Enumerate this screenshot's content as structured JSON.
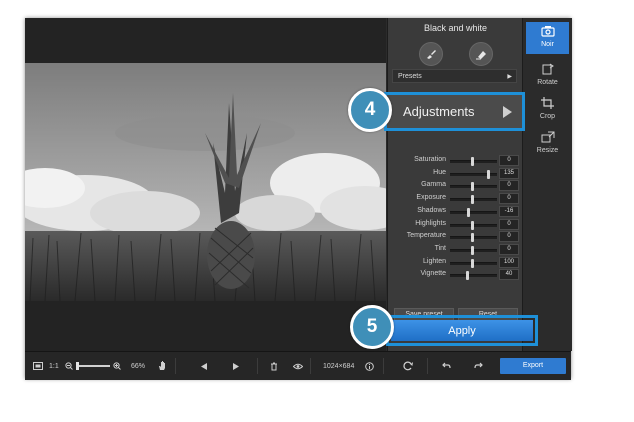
{
  "panel": {
    "title": "Black and white",
    "presets_label": "Presets",
    "adjustments_label": "Adjustments",
    "sliders": [
      {
        "label": "Saturation",
        "value": "0",
        "level": 0.5
      },
      {
        "label": "Hue",
        "value": "135",
        "level": 0.87
      },
      {
        "label": "Gamma",
        "value": "0",
        "level": 0.5
      },
      {
        "label": "Exposure",
        "value": "0",
        "level": 0.5
      },
      {
        "label": "Shadows",
        "value": "-16",
        "level": 0.42
      },
      {
        "label": "Highlights",
        "value": "0",
        "level": 0.5
      },
      {
        "label": "Temperature",
        "value": "0",
        "level": 0.5
      },
      {
        "label": "Tint",
        "value": "0",
        "level": 0.5
      },
      {
        "label": "Lighten",
        "value": "100",
        "level": 0.5
      },
      {
        "label": "Vignette",
        "value": "40",
        "level": 0.38
      }
    ],
    "save_preset_label": "Save preset",
    "reset_label": "Reset",
    "apply_label": "Apply"
  },
  "right_tools": [
    {
      "label": "Noir",
      "icon": "camera-icon",
      "active": true
    },
    {
      "label": "Rotate",
      "icon": "rotate-icon",
      "active": false
    },
    {
      "label": "Crop",
      "icon": "crop-icon",
      "active": false
    },
    {
      "label": "Resize",
      "icon": "resize-icon",
      "active": false
    }
  ],
  "bottom": {
    "ratio_label": "1:1",
    "zoom_value": "66%",
    "dimensions": "1024×684",
    "export_label": "Export"
  },
  "callouts": {
    "adjustments_step": "4",
    "apply_step": "5"
  },
  "colors": {
    "accent": "#2f7bd1",
    "callout": "#1e90d8",
    "badge": "#3f8fb8"
  }
}
